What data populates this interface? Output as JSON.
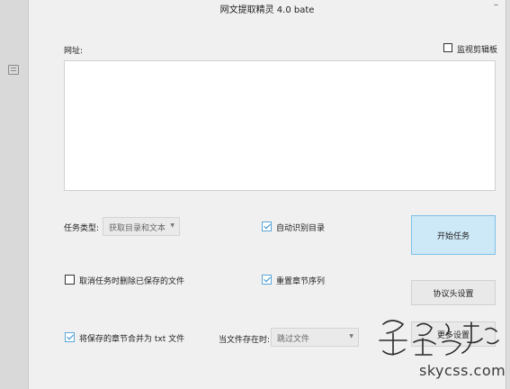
{
  "window": {
    "title": "网文提取精灵 4.0 bate",
    "minimize_label": "–"
  },
  "url_section": {
    "label": "网址:",
    "monitor_clipboard_label": "监视剪辑板",
    "monitor_clipboard_checked": false,
    "url_value": ""
  },
  "task": {
    "type_label": "任务类型:",
    "type_value": "获取目录和文本"
  },
  "options": {
    "auto_detect_label": "自动识别目录",
    "auto_detect_checked": true,
    "cancel_delete_label": "取消任务时删除已保存的文件",
    "cancel_delete_checked": false,
    "reorder_label": "重置章节序列",
    "reorder_checked": true,
    "merge_label": "将保存的章节合并为 txt 文件",
    "merge_checked": true,
    "file_exists_label": "当文件存在时:",
    "file_exists_value": "跳过文件"
  },
  "buttons": {
    "start_label": "开始任务",
    "protocol_label": "协议头设置",
    "third_label": "更多设置"
  },
  "watermark": {
    "text": "skycss.com"
  },
  "icons": {
    "sidebar_icon": "window-icon",
    "dropdown_icon": "chevron-down-icon",
    "checkbox_icon": "checkmark-icon"
  },
  "colors": {
    "primary_button_bg": "#cde8f6",
    "primary_button_border": "#7fc0e6",
    "check_color": "#2f8fd0"
  }
}
